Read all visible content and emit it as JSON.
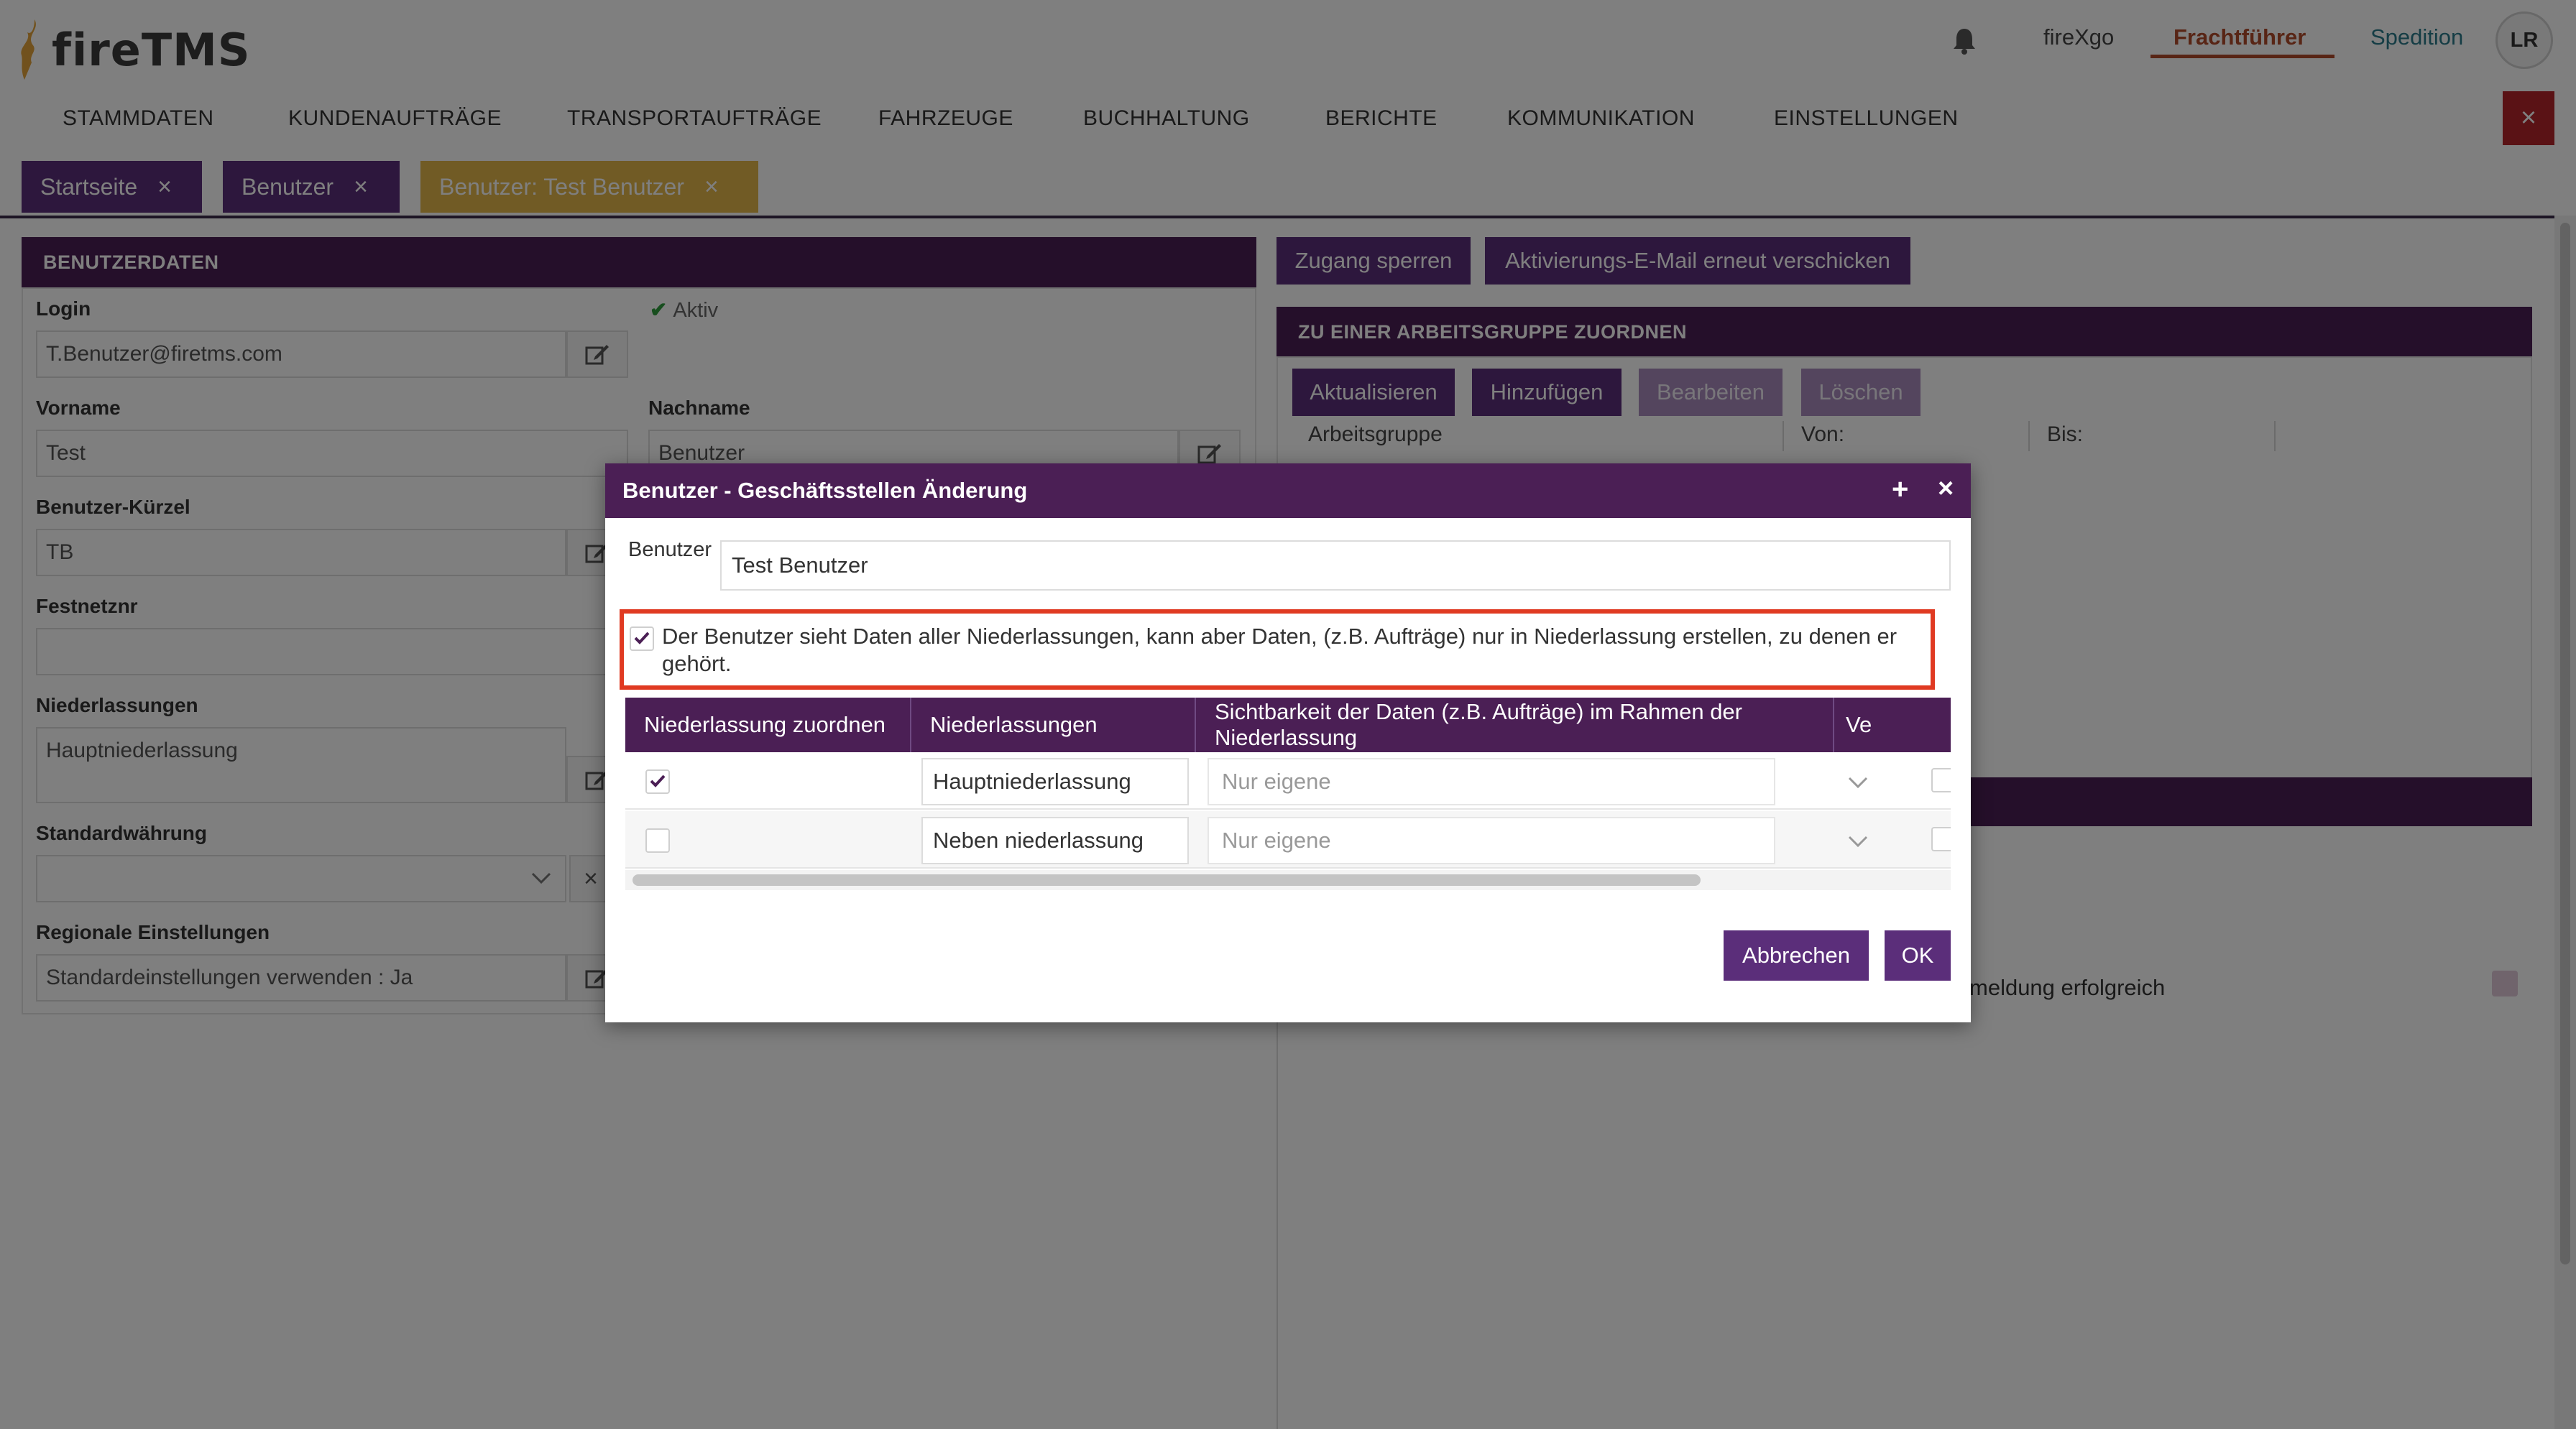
{
  "header": {
    "logo_text": "fireTMS",
    "links": {
      "firexgo": "fireXgo",
      "frachtfuehrer": "Frachtführer",
      "spedition": "Spedition"
    },
    "avatar_initials": "LR",
    "accent_color": "#b04a2a",
    "icons": {
      "bell": "bell-icon",
      "close": "close-icon"
    }
  },
  "nav": {
    "items": [
      "STAMMDATEN",
      "KUNDENAUFTRÄGE",
      "TRANSPORTAUFTRÄGE",
      "FAHRZEUGE",
      "BUCHHALTUNG",
      "BERICHTE",
      "KOMMUNIKATION",
      "EINSTELLUNGEN"
    ],
    "close_label": "×"
  },
  "tabs": [
    {
      "label": "Startseite",
      "close": "×"
    },
    {
      "label": "Benutzer",
      "close": "×"
    },
    {
      "label": "Benutzer: Test Benutzer",
      "close": "×",
      "active": true
    }
  ],
  "user_form": {
    "section_title": "BENUTZERDATEN",
    "status": "Aktiv",
    "login_label": "Login",
    "login_value": "T.Benutzer@firetms.com",
    "vorname_label": "Vorname",
    "vorname_value": "Test",
    "nachname_label": "Nachname",
    "nachname_value": "Benutzer",
    "kuerzel_label": "Benutzer-Kürzel",
    "kuerzel_value": "TB",
    "festnetz_label": "Festnetznr",
    "festnetz_value": "",
    "niederlassungen_label": "Niederlassungen",
    "niederlassungen_value": "Hauptniederlassung",
    "waehrung_label": "Standardwährung",
    "waehrung_value": "",
    "regional_label": "Regionale Einstellungen",
    "regional_value": "Standardeinstellungen verwenden : Ja"
  },
  "right_panel": {
    "btn_lock": "Zugang sperren",
    "btn_resend": "Aktivierungs-E-Mail erneut verschicken",
    "workgroup_title": "ZU EINER ARBEITSGRUPPE ZUORDNEN",
    "btn_refresh": "Aktualisieren",
    "btn_add": "Hinzufügen",
    "btn_edit": "Bearbeiten",
    "btn_delete": "Löschen",
    "columns": [
      "Arbeitsgruppe",
      "Von:",
      "Bis:"
    ],
    "meldung_text": "meldung erfolgreich"
  },
  "modal": {
    "title": "Benutzer - Geschäftsstellen Änderung",
    "plus": "+",
    "close": "×",
    "benutzer_label": "Benutzer",
    "benutzer_value": "Test Benutzer",
    "info_checked": true,
    "info_text": "Der Benutzer sieht Daten aller Niederlassungen, kann aber Daten, (z.B. Aufträge) nur in Niederlassung erstellen, zu denen er gehört.",
    "highlight_color": "#e03a22",
    "table_headers": [
      "Niederlassung zuordnen",
      "Niederlassungen",
      "Sichtbarkeit der Daten (z.B. Aufträge) im Rahmen der Niederlassung",
      "Ve"
    ],
    "rows": [
      {
        "assigned": true,
        "name": "Hauptniederlassung",
        "visibility": "Nur eigene"
      },
      {
        "assigned": false,
        "name": "Neben niederlassung",
        "visibility": "Nur eigene"
      }
    ],
    "cancel_label": "Abbrechen",
    "ok_label": "OK"
  }
}
